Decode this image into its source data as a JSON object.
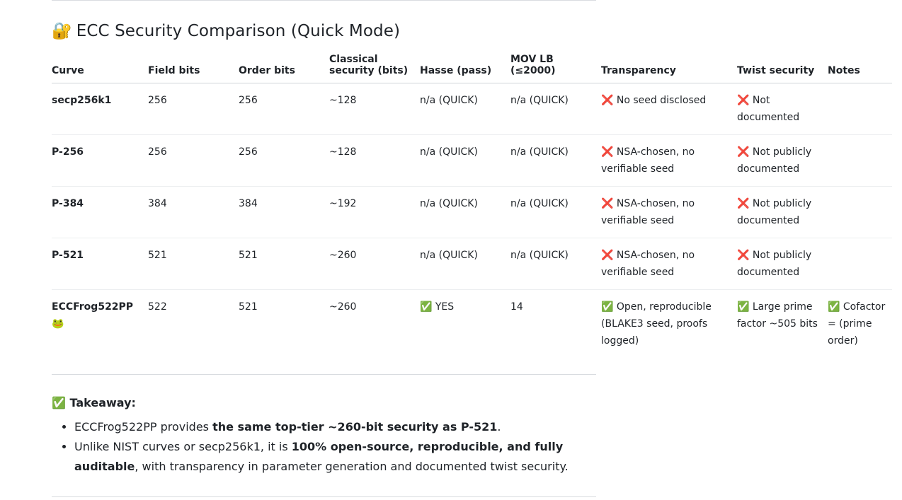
{
  "heading": {
    "icon": "🔐",
    "text": "ECC Security Comparison (Quick Mode)"
  },
  "table": {
    "headers": [
      "Curve",
      "Field bits",
      "Order bits",
      "Classical security (bits)",
      "Hasse (pass)",
      "MOV LB (≤2000)",
      "Transparency",
      "Twist security",
      "Notes"
    ],
    "rows": [
      [
        "secp256k1",
        "256",
        "256",
        "~128",
        "n/a (QUICK)",
        "n/a (QUICK)",
        "❌ No seed disclosed",
        "❌ Not documented",
        ""
      ],
      [
        "P-256",
        "256",
        "256",
        "~128",
        "n/a (QUICK)",
        "n/a (QUICK)",
        "❌ NSA-chosen, no verifiable seed",
        "❌ Not publicly documented",
        ""
      ],
      [
        "P-384",
        "384",
        "384",
        "~192",
        "n/a (QUICK)",
        "n/a (QUICK)",
        "❌ NSA-chosen, no verifiable seed",
        "❌ Not publicly documented",
        ""
      ],
      [
        "P-521",
        "521",
        "521",
        "~260",
        "n/a (QUICK)",
        "n/a (QUICK)",
        "❌ NSA-chosen, no verifiable seed",
        "❌ Not publicly documented",
        ""
      ],
      [
        "ECCFrog522PP 🐸",
        "522",
        "521",
        "~260",
        "✅ YES",
        "14",
        "✅ Open, reproducible (BLAKE3 seed, proofs logged)",
        "✅ Large prime factor ~505 bits",
        "✅ Cofactor = (prime order)"
      ]
    ]
  },
  "takeaway": {
    "title": "✅ Takeaway:",
    "bullet1": {
      "pre": "ECCFrog522PP provides ",
      "bold": "the same top-tier ~260-bit security as P-521",
      "post": "."
    },
    "bullet2": {
      "pre": "Unlike NIST curves or secp256k1, it is ",
      "bold": "100% open-source, reproducible, and fully auditable",
      "post": ", with transparency in parameter generation and documented twist security."
    }
  }
}
